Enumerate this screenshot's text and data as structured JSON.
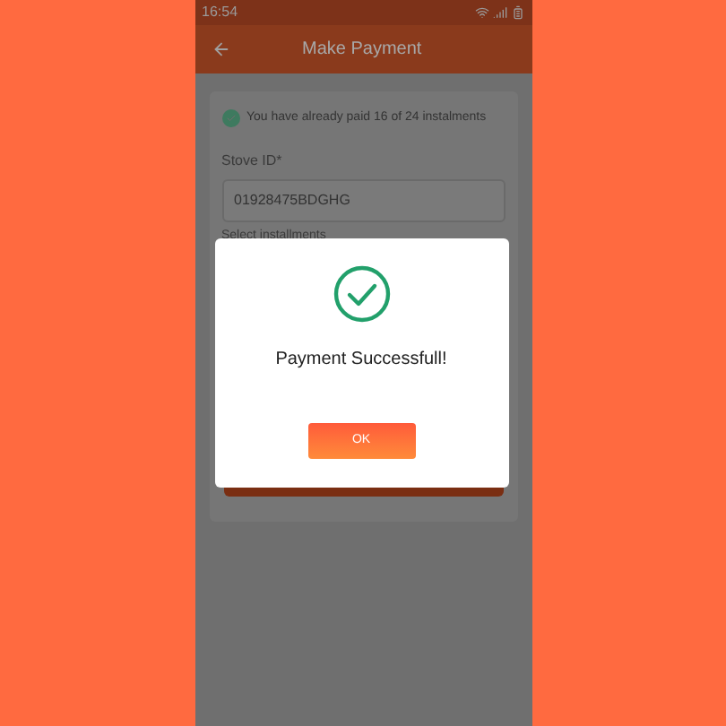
{
  "status_bar": {
    "time": "16:54"
  },
  "app_bar": {
    "title": "Make Payment"
  },
  "notice": {
    "text": "You have already paid 16 of 24 instalments"
  },
  "stove_id": {
    "label": "Stove ID*",
    "value": "01928475BDGHG"
  },
  "installments": {
    "label": "Select installments"
  },
  "dialog": {
    "message": "Payment Successfull!",
    "button": "OK"
  }
}
